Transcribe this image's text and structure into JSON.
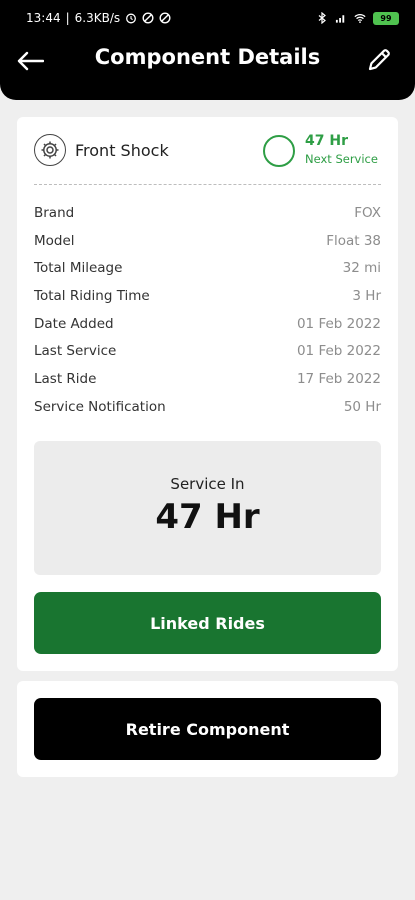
{
  "status_bar": {
    "time": "13:44",
    "network_speed": "6.3KB/s",
    "left_icons": [
      "alarm-icon",
      "dnd-icon",
      "dnd-icon"
    ],
    "right_icons": [
      "bluetooth-icon",
      "signal-icon",
      "wifi-icon"
    ],
    "battery": "99"
  },
  "header": {
    "title": "Component Details",
    "back_icon": "back-arrow-icon",
    "edit_icon": "pencil-icon"
  },
  "component": {
    "icon": "gear-icon",
    "name": "Front Shock",
    "next_service_value": "47 Hr",
    "next_service_label": "Next Service"
  },
  "specs": [
    {
      "label": "Brand",
      "value": "FOX"
    },
    {
      "label": "Model",
      "value": "Float 38"
    },
    {
      "label": "Total Mileage",
      "value": "32 mi"
    },
    {
      "label": "Total Riding Time",
      "value": "3 Hr"
    },
    {
      "label": "Date Added",
      "value": "01 Feb 2022"
    },
    {
      "label": "Last Service",
      "value": "01 Feb 2022"
    },
    {
      "label": "Last Ride",
      "value": "17 Feb 2022"
    },
    {
      "label": "Service Notification",
      "value": "50 Hr"
    }
  ],
  "service_box": {
    "label": "Service In",
    "value": "47 Hr"
  },
  "buttons": {
    "linked_rides": "Linked Rides",
    "retire": "Retire Component"
  },
  "colors": {
    "accent_green": "#2e9e45",
    "button_green": "#197530",
    "dark": "#000000"
  }
}
